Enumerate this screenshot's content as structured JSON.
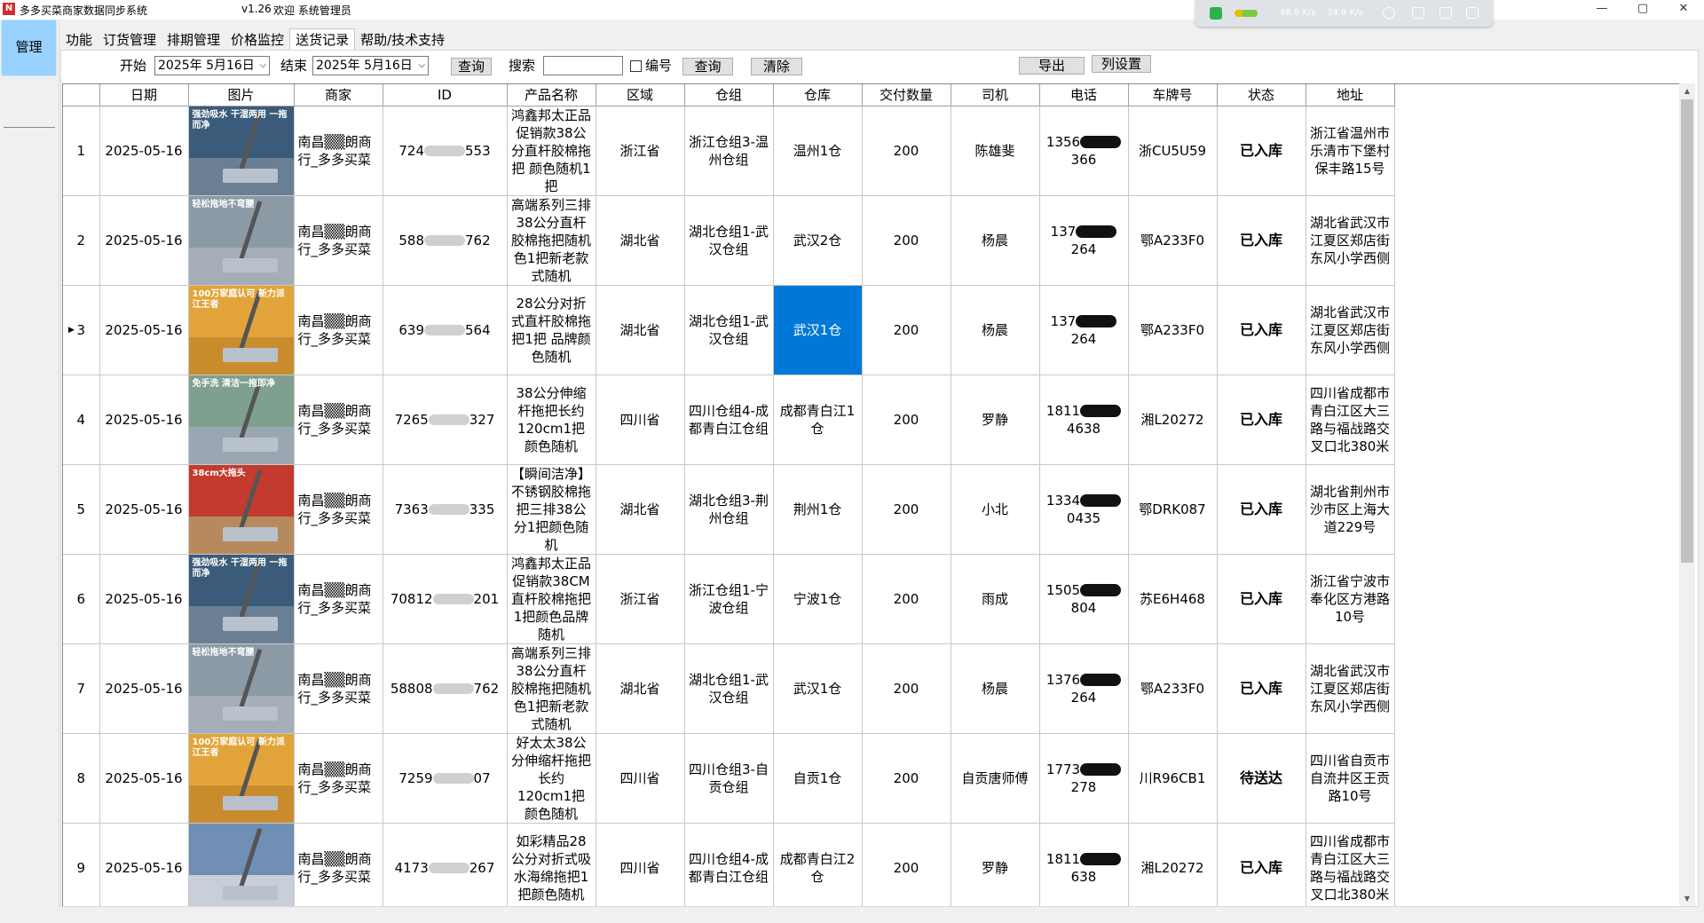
{
  "window": {
    "app_icon": "N",
    "title": "多多买菜商家数据同步系统",
    "version": "v1.26",
    "welcome": "欢迎 系统管理员",
    "controls": [
      "—",
      "▢",
      "✕"
    ]
  },
  "net_widget": {
    "up_speed": "48.9 K/s",
    "down_speed": "34.9 K/s"
  },
  "left": {
    "manage_label": "管理"
  },
  "tabs": [
    "功能",
    "订货管理",
    "排期管理",
    "价格监控",
    "送货记录",
    "帮助/技术支持"
  ],
  "active_tab": "送货记录",
  "toolbar": {
    "start_label": "开始",
    "start_date": "2025年  5月16日",
    "end_label": "结束",
    "end_date": "2025年  5月16日",
    "query1": "查询",
    "search_label": "搜索",
    "search_value": "",
    "code_label": "编号",
    "query2": "查询",
    "clear": "清除",
    "export": "导出",
    "columns": "列设置"
  },
  "table": {
    "headers": [
      "日期",
      "图片",
      "商家",
      "ID",
      "产品名称",
      "区域",
      "仓组",
      "仓库",
      "交付数量",
      "司机",
      "电话",
      "车牌号",
      "状态",
      "地址"
    ],
    "rows": [
      {
        "n": "1",
        "date": "2025-05-16",
        "merchant": "南昌▒▒朗商行_多多买菜",
        "id_a": "724",
        "id_b": "553",
        "product": "鸿鑫邦太正品促销款38公分直杆胶棉拖把 颜色随机1把",
        "region": "浙江省",
        "group": "浙江仓组3-温州仓组",
        "warehouse": "温州1仓",
        "qty": "200",
        "driver": "陈雄斐",
        "phone_a": "1356",
        "phone_b": "366",
        "plate": "浙CU5U59",
        "status": "已入库",
        "address": "浙江省温州市乐清市下堡村保丰路15号",
        "img_tag": "强劲吸水 干湿两用 一拖而净",
        "img_top": "#3b5b7a",
        "img_floor": "#6b7f94"
      },
      {
        "n": "2",
        "date": "2025-05-16",
        "merchant": "南昌▒▒朗商行_多多买菜",
        "id_a": "588",
        "id_b": "762",
        "product": "高端系列三排38公分直杆胶棉拖把随机色1把新老款式随机",
        "region": "湖北省",
        "group": "湖北仓组1-武汉仓组",
        "warehouse": "武汉2仓",
        "qty": "200",
        "driver": "杨晨",
        "phone_a": "137",
        "phone_b": "264",
        "plate": "鄂A233F0",
        "status": "已入库",
        "address": "湖北省武汉市江夏区郑店街东风小学西侧",
        "img_tag": "轻松拖地不弯腰",
        "img_top": "#8c9aa6",
        "img_floor": "#a5aeb7"
      },
      {
        "n": "3",
        "date": "2025-05-16",
        "merchant": "南昌▒▒朗商行_多多买菜",
        "id_a": "639",
        "id_b": "564",
        "product": "28公分对折式直杆胶棉拖把1把 品牌颜色随机",
        "region": "湖北省",
        "group": "湖北仓组1-武汉仓组",
        "warehouse": "武汉1仓",
        "qty": "200",
        "driver": "杨晨",
        "phone_a": "137",
        "phone_b": "264",
        "plate": "鄂A233F0",
        "status": "已入库",
        "address": "湖北省武汉市江夏区郑店街东风小学西侧",
        "img_tag": "100万家庭认可 新力派江王者",
        "img_top": "#e2a43a",
        "img_floor": "#c98c2c"
      },
      {
        "n": "4",
        "date": "2025-05-16",
        "merchant": "南昌▒▒朗商行_多多买菜",
        "id_a": "7265",
        "id_b": "327",
        "product": "38公分伸缩杆拖把长约120cm1把颜色随机",
        "region": "四川省",
        "group": "四川仓组4-成都青白江仓组",
        "warehouse": "成都青白江1仓",
        "qty": "200",
        "driver": "罗静",
        "phone_a": "1811",
        "phone_b": "4638",
        "plate": "湘L20272",
        "status": "已入库",
        "address": "四川省成都市青白江区大三路与福战路交叉口北380米",
        "img_tag": "免手洗 清洁一拖即净",
        "img_top": "#7fa08f",
        "img_floor": "#9aa7b3"
      },
      {
        "n": "5",
        "date": "2025-05-16",
        "merchant": "南昌▒▒朗商行_多多买菜",
        "id_a": "7363",
        "id_b": "335",
        "product": "【瞬间洁净】不锈钢胶棉拖把三排38公分1把颜色随机",
        "region": "湖北省",
        "group": "湖北仓组3-荆州仓组",
        "warehouse": "荆州1仓",
        "qty": "200",
        "driver": "小北",
        "phone_a": "1334",
        "phone_b": "0435",
        "plate": "鄂DRK087",
        "status": "已入库",
        "address": "湖北省荆州市沙市区上海大道229号",
        "img_tag": "38cm大拖头",
        "img_top": "#c23b2e",
        "img_floor": "#b68a5c"
      },
      {
        "n": "6",
        "date": "2025-05-16",
        "merchant": "南昌▒▒朗商行_多多买菜",
        "id_a": "70812",
        "id_b": "201",
        "product": "鸿鑫邦太正品促销款38CM直杆胶棉拖把1把颜色品牌随机",
        "region": "浙江省",
        "group": "浙江仓组1-宁波仓组",
        "warehouse": "宁波1仓",
        "qty": "200",
        "driver": "雨成",
        "phone_a": "1505",
        "phone_b": "804",
        "plate": "苏E6H468",
        "status": "已入库",
        "address": "浙江省宁波市奉化区方港路10号",
        "img_tag": "强劲吸水 干湿两用 一拖而净",
        "img_top": "#3b5b7a",
        "img_floor": "#6b7f94"
      },
      {
        "n": "7",
        "date": "2025-05-16",
        "merchant": "南昌▒▒朗商行_多多买菜",
        "id_a": "58808",
        "id_b": "762",
        "product": "高端系列三排38公分直杆胶棉拖把随机色1把新老款式随机",
        "region": "湖北省",
        "group": "湖北仓组1-武汉仓组",
        "warehouse": "武汉1仓",
        "qty": "200",
        "driver": "杨晨",
        "phone_a": "1376",
        "phone_b": "264",
        "plate": "鄂A233F0",
        "status": "已入库",
        "address": "湖北省武汉市江夏区郑店街东风小学西侧",
        "img_tag": "轻松拖地不弯腰",
        "img_top": "#8c9aa6",
        "img_floor": "#a5aeb7"
      },
      {
        "n": "8",
        "date": "2025-05-16",
        "merchant": "南昌▒▒朗商行_多多买菜",
        "id_a": "7259",
        "id_b": "07",
        "product": "好太太38公分伸缩杆拖把长约120cm1把颜色随机",
        "region": "四川省",
        "group": "四川仓组3-自贡仓组",
        "warehouse": "自贡1仓",
        "qty": "200",
        "driver": "自贡唐师傅",
        "phone_a": "1773",
        "phone_b": "278",
        "plate": "川R96CB1",
        "status": "待送达",
        "address": "四川省自贡市自流井区王贡路10号",
        "img_tag": "100万家庭认可 新力派江王者",
        "img_top": "#e2a43a",
        "img_floor": "#c98c2c"
      },
      {
        "n": "9",
        "date": "2025-05-16",
        "merchant": "南昌▒▒朗商行_多多买菜",
        "id_a": "4173",
        "id_b": "267",
        "product": "如彩精品28公分对折式吸水海绵拖把1把颜色随机",
        "region": "四川省",
        "group": "四川仓组4-成都青白江仓组",
        "warehouse": "成都青白江2仓",
        "qty": "200",
        "driver": "罗静",
        "phone_a": "1811",
        "phone_b": "638",
        "plate": "湘L20272",
        "status": "已入库",
        "address": "四川省成都市青白江区大三路与福战路交叉口北380米",
        "img_tag": "",
        "img_top": "#6f8fb5",
        "img_floor": "#c8cfd8"
      }
    ]
  }
}
